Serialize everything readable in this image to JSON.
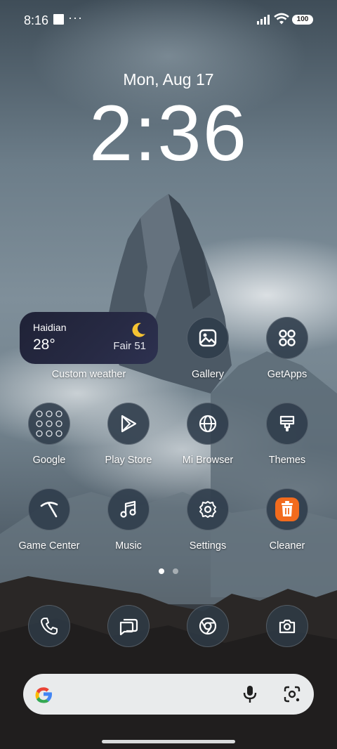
{
  "status_bar": {
    "time": "8:16",
    "dots": "···",
    "battery": "100"
  },
  "lockclock": {
    "date": "Mon, Aug 17",
    "time": "2:36"
  },
  "weather_widget": {
    "city": "Haidian",
    "temperature": "28°",
    "condition": "Fair 51",
    "label": "Custom weather",
    "icon": "moon-icon"
  },
  "apps": [
    {
      "label": "Gallery",
      "icon": "gallery-icon"
    },
    {
      "label": "GetApps",
      "icon": "getapps-icon"
    },
    {
      "label": "Google",
      "icon": "google-folder-icon"
    },
    {
      "label": "Play Store",
      "icon": "play-store-icon"
    },
    {
      "label": "Mi Browser",
      "icon": "globe-icon"
    },
    {
      "label": "Themes",
      "icon": "themes-brush-icon"
    },
    {
      "label": "Game Center",
      "icon": "game-center-icon"
    },
    {
      "label": "Music",
      "icon": "music-icon"
    },
    {
      "label": "Settings",
      "icon": "gear-icon"
    },
    {
      "label": "Cleaner",
      "icon": "trash-icon"
    }
  ],
  "page_indicator": {
    "pages": 2,
    "current": 1
  },
  "dock": [
    {
      "icon": "phone-icon"
    },
    {
      "icon": "messages-icon"
    },
    {
      "icon": "chrome-icon"
    },
    {
      "icon": "camera-icon"
    }
  ],
  "search_bar": {
    "logo": "google-g-icon",
    "mic": "mic-icon",
    "lens": "lens-icon"
  },
  "colors": {
    "cleaner_accent": "#f26b1d",
    "weather_bg": "#24273f"
  }
}
